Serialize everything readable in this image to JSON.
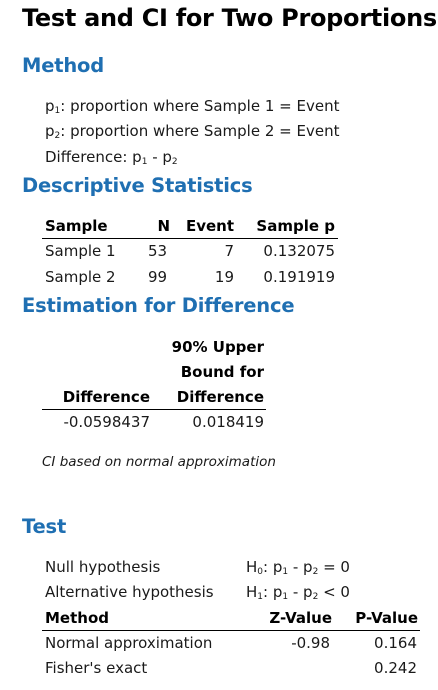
{
  "title": "Test and CI for Two Proportions",
  "method": {
    "heading": "Method",
    "p1_symbol": "p",
    "p1_sub": "1",
    "p1_desc": ": proportion where Sample 1 = Event",
    "p2_symbol": "p",
    "p2_sub": "2",
    "p2_desc": ": proportion where Sample 2 = Event",
    "diff_label": "Difference: p",
    "diff_sub1": "1",
    "diff_mid": " - p",
    "diff_sub2": "2"
  },
  "descriptive": {
    "heading": "Descriptive Statistics",
    "columns": [
      "Sample",
      "N",
      "Event",
      "Sample p"
    ],
    "rows": [
      [
        "Sample 1",
        "53",
        "7",
        "0.132075"
      ],
      [
        "Sample 2",
        "99",
        "19",
        "0.191919"
      ]
    ]
  },
  "estimation": {
    "heading": "Estimation for Difference",
    "col1": "Difference",
    "col2_line1": "90% Upper",
    "col2_line2": "Bound for",
    "col2_line3": "Difference",
    "difference": "-0.0598437",
    "upper_bound": "0.018419",
    "note": "CI based on normal approximation"
  },
  "test": {
    "heading": "Test",
    "null_label": "Null hypothesis",
    "null_h": "H",
    "null_h_sub": "0",
    "null_p1": ": p",
    "null_p1_sub": "1",
    "null_p2": " - p",
    "null_p2_sub": "2",
    "null_rel": " = 0",
    "alt_label": "Alternative hypothesis",
    "alt_h": "H",
    "alt_h_sub": "1",
    "alt_p1": ": p",
    "alt_p1_sub": "1",
    "alt_p2": " - p",
    "alt_p2_sub": "2",
    "alt_rel": " < 0",
    "columns": [
      "Method",
      "Z-Value",
      "P-Value"
    ],
    "rows": [
      [
        "Normal approximation",
        "-0.98",
        "0.164"
      ],
      [
        "Fisher's exact",
        "",
        "0.242"
      ]
    ]
  }
}
